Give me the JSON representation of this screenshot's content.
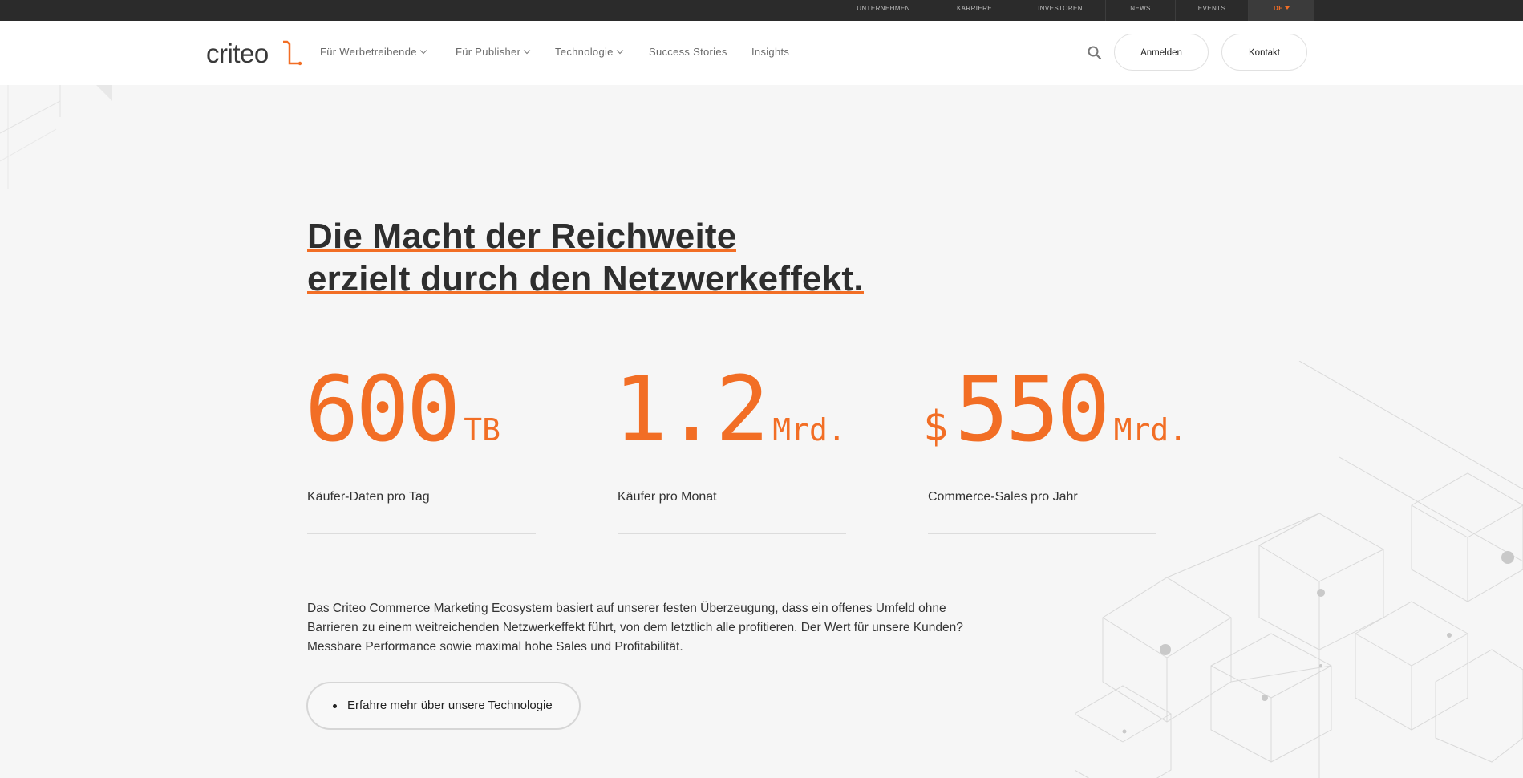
{
  "topbar": {
    "links": [
      "UNTERNEHMEN",
      "KARRIERE",
      "INVESTOREN",
      "NEWS",
      "EVENTS"
    ],
    "language": "DE"
  },
  "nav": {
    "logo": "criteo",
    "items": [
      {
        "label": "Für Werbetreibende",
        "has_dropdown": true
      },
      {
        "label": "Für Publisher",
        "has_dropdown": true
      },
      {
        "label": "Technologie",
        "has_dropdown": true
      },
      {
        "label": "Success Stories",
        "has_dropdown": false
      },
      {
        "label": "Insights",
        "has_dropdown": false
      }
    ],
    "login": "Anmelden",
    "contact": "Kontakt"
  },
  "hero": {
    "headline_line1": "Die Macht der Reichweite",
    "headline_line2": "erzielt durch den Netzwerkeffekt."
  },
  "stats": [
    {
      "prefix": "",
      "value": "600",
      "unit": "TB",
      "label": "Käufer-Daten pro Tag"
    },
    {
      "prefix": "",
      "value": "1.2",
      "unit": "Mrd.",
      "label": "Käufer pro Monat"
    },
    {
      "prefix": "$",
      "value": "550",
      "unit": "Mrd.",
      "label": "Commerce-Sales pro Jahr"
    }
  ],
  "description": "Das Criteo Commerce Marketing Ecosystem basiert auf unserer festen Überzeugung, dass ein offenes Umfeld ohne Barrieren zu einem weitreichenden Netzwerkeffekt führt, von dem letztlich alle profitieren. Der Wert für unsere Kunden? Messbare Performance sowie maximal hohe Sales und Profitabilität.",
  "cta": "Erfahre mehr über unsere Technologie",
  "colors": {
    "accent": "#f26e25",
    "text": "#2e2e2e",
    "topbar": "#2b2b2b"
  }
}
